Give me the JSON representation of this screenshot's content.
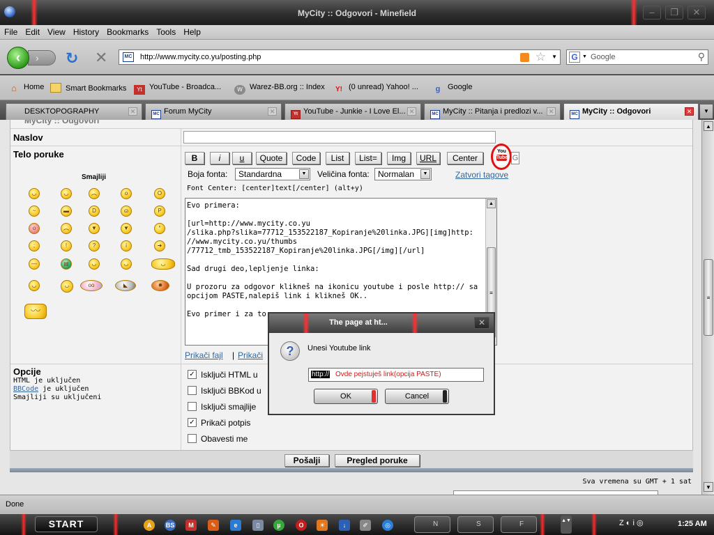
{
  "window": {
    "title": "MyCity :: Odgovori - Minefield"
  },
  "menu": [
    "File",
    "Edit",
    "View",
    "History",
    "Bookmarks",
    "Tools",
    "Help"
  ],
  "nav": {
    "url": "http://www.mycity.co.yu/posting.php",
    "search_placeholder": "Google"
  },
  "bookmarks": [
    {
      "label": "Home"
    },
    {
      "label": "Smart Bookmarks"
    },
    {
      "label": "YouTube - Broadca..."
    },
    {
      "label": "Warez-BB.org :: Index"
    },
    {
      "label": "(0 unread) Yahoo! ..."
    },
    {
      "label": "Google"
    }
  ],
  "tabs": [
    {
      "label": "DESKTOPOGRAPHY"
    },
    {
      "label": "Forum MyCity"
    },
    {
      "label": "YouTube - Junkie - I Love El..."
    },
    {
      "label": "MyCity :: Pitanja i predlozi v..."
    },
    {
      "label": "MyCity :: Odgovori"
    }
  ],
  "form": {
    "breadcrumb": "MyCity :: Odgovori",
    "subject_label": "Naslov",
    "subject_value": "",
    "body_label": "Telo poruke",
    "smilies_title": "Smajliji",
    "bbcode_buttons": [
      "B",
      "i",
      "u",
      "Quote",
      "Code",
      "List",
      "List=",
      "Img",
      "URL",
      "Center"
    ],
    "youtube_icon_text": "You Tube",
    "font_color_label": "Boja fonta:",
    "font_color_value": "Standardna",
    "font_size_label": "Veličina fonta:",
    "font_size_value": "Normalan",
    "close_tags": "Zatvori tagove",
    "hint": "Font Center: [center]text[/center] (alt+y)",
    "body_text": "Evo primera:\n\n[url=http://www.mycity.co.yu\n/slika.php?slika=77712_153522187_Kopiranje%20linka.JPG][img]http:\n//www.mycity.co.yu/thumbs\n/77712_tmb_153522187_Kopiranje%20linka.JPG[/img][/url]\n\nSad drugi deo,lepljenje linka:\n\nU prozoru za odgovor klikneš na ikonicu youtube i posle http:// sa\nopcijom PASTE,nalepiš link i klikneš OK..\n\nEvo primer i za to:",
    "attach_file": "Prikači fajl",
    "attach_separator": "|",
    "attach_other": "Prikači",
    "options_label": "Opcije",
    "options_info": [
      "HTML je uključen",
      "BBCode je uključen",
      "Smajliji su uključeni"
    ],
    "options_info_link": "BBCode",
    "options_info_rest": " je uključen",
    "checkboxes": [
      {
        "label": "Isključi HTML u",
        "checked": true
      },
      {
        "label": "Isključi BBKod u",
        "checked": false
      },
      {
        "label": "Isključi smajlije",
        "checked": false
      },
      {
        "label": "Prikači potpis",
        "checked": true
      },
      {
        "label": "Obavesti me",
        "checked": false
      }
    ],
    "submit": "Pošalji",
    "preview": "Pregled poruke",
    "timezone": "Sva vremena su GMT + 1 sat"
  },
  "dialog": {
    "title": "The page at ht...",
    "prompt": "Unesi Youtube link",
    "input_selected": "http://",
    "input_note": "Ovde pejstuješ link(opcija PASTE)",
    "ok": "OK",
    "cancel": "Cancel"
  },
  "status": "Done",
  "taskbar": {
    "start": "START",
    "clock": "1:25 AM"
  },
  "colors": {
    "highlight_red": "#e01010",
    "link_blue": "#33679b"
  }
}
